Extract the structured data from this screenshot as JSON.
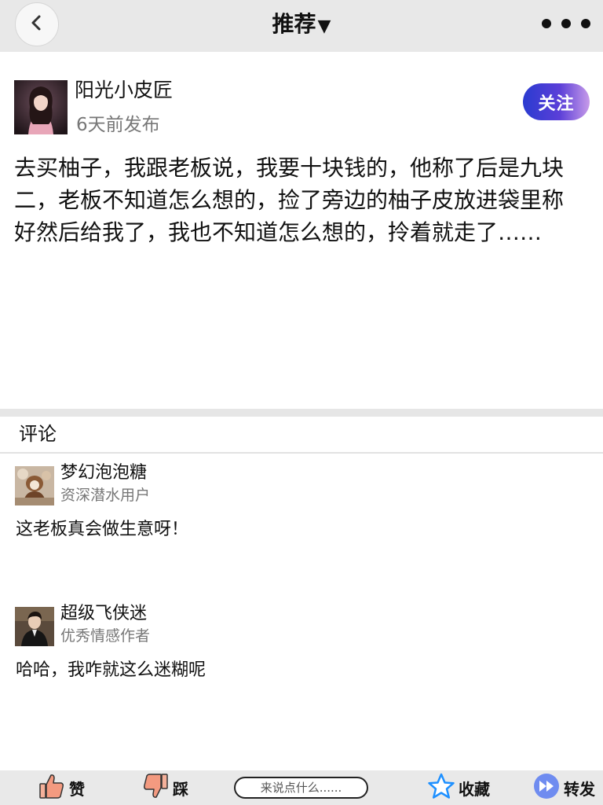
{
  "nav": {
    "title": "推荐",
    "caret": "▼",
    "back_icon": "chevron-left-icon",
    "more_icon": "more-dots-icon"
  },
  "post": {
    "author": "阳光小皮匠",
    "time": "6天前发布",
    "follow_label": "关注",
    "content": "去买柚子，我跟老板说，我要十块钱的，他称了后是九块二，老板不知道怎么想的，捡了旁边的柚子皮放进袋里称好然后给我了，我也不知道怎么想的，拎着就走了……"
  },
  "comments": {
    "heading": "评论",
    "items": [
      {
        "name": "梦幻泡泡糖",
        "title": "资深潜水用户",
        "text": "这老板真会做生意呀！"
      },
      {
        "name": "超级飞侠迷",
        "title": "优秀情感作者",
        "text": "哈哈，我咋就这么迷糊呢"
      }
    ]
  },
  "bottombar": {
    "like_label": "赞",
    "dislike_label": "踩",
    "comment_placeholder": "来说点什么......",
    "favorite_label": "收藏",
    "share_label": "转发"
  },
  "colors": {
    "follow_gradient_start": "#2a3bd0",
    "follow_gradient_end": "#c79be9",
    "like_icon": "#f08a6a",
    "star_icon": "#1e90ff",
    "share_icon": "#6f8cf0"
  }
}
